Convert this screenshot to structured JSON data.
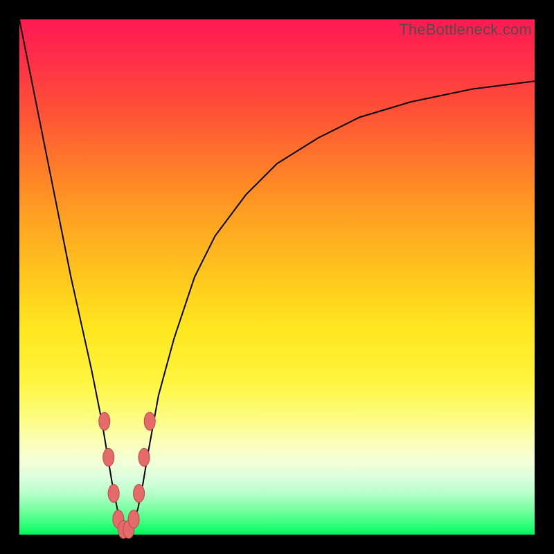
{
  "watermark": "TheBottleneck.com",
  "colors": {
    "frame": "#000000",
    "curve_stroke": "#000000",
    "marker_fill": "#e66a6a",
    "marker_stroke": "#b24848",
    "gradient_top": "#ff1a52",
    "gradient_bottom": "#00f55b"
  },
  "chart_data": {
    "type": "line",
    "title": "",
    "xlabel": "",
    "ylabel": "",
    "xlim": [
      0,
      100
    ],
    "ylim": [
      0,
      100
    ],
    "series": [
      {
        "name": "bottleneck-curve",
        "x": [
          0,
          2,
          4,
          6,
          8,
          10,
          12,
          14,
          16,
          17,
          18,
          19,
          20,
          21,
          22,
          23,
          24,
          25,
          27,
          30,
          34,
          38,
          44,
          50,
          58,
          66,
          76,
          88,
          100
        ],
        "y": [
          100,
          90,
          80,
          70,
          60,
          50,
          41,
          32,
          22,
          16,
          10,
          5,
          2,
          1,
          2,
          5,
          10,
          16,
          27,
          38,
          50,
          58,
          66,
          72,
          77,
          81,
          84,
          86.5,
          88
        ]
      }
    ],
    "markers": [
      {
        "x": 16.5,
        "y": 22
      },
      {
        "x": 17.3,
        "y": 15
      },
      {
        "x": 18.3,
        "y": 8
      },
      {
        "x": 19.2,
        "y": 3
      },
      {
        "x": 20.2,
        "y": 1
      },
      {
        "x": 21.2,
        "y": 1
      },
      {
        "x": 22.2,
        "y": 3
      },
      {
        "x": 23.2,
        "y": 8
      },
      {
        "x": 24.2,
        "y": 15
      },
      {
        "x": 25.3,
        "y": 22
      }
    ]
  }
}
